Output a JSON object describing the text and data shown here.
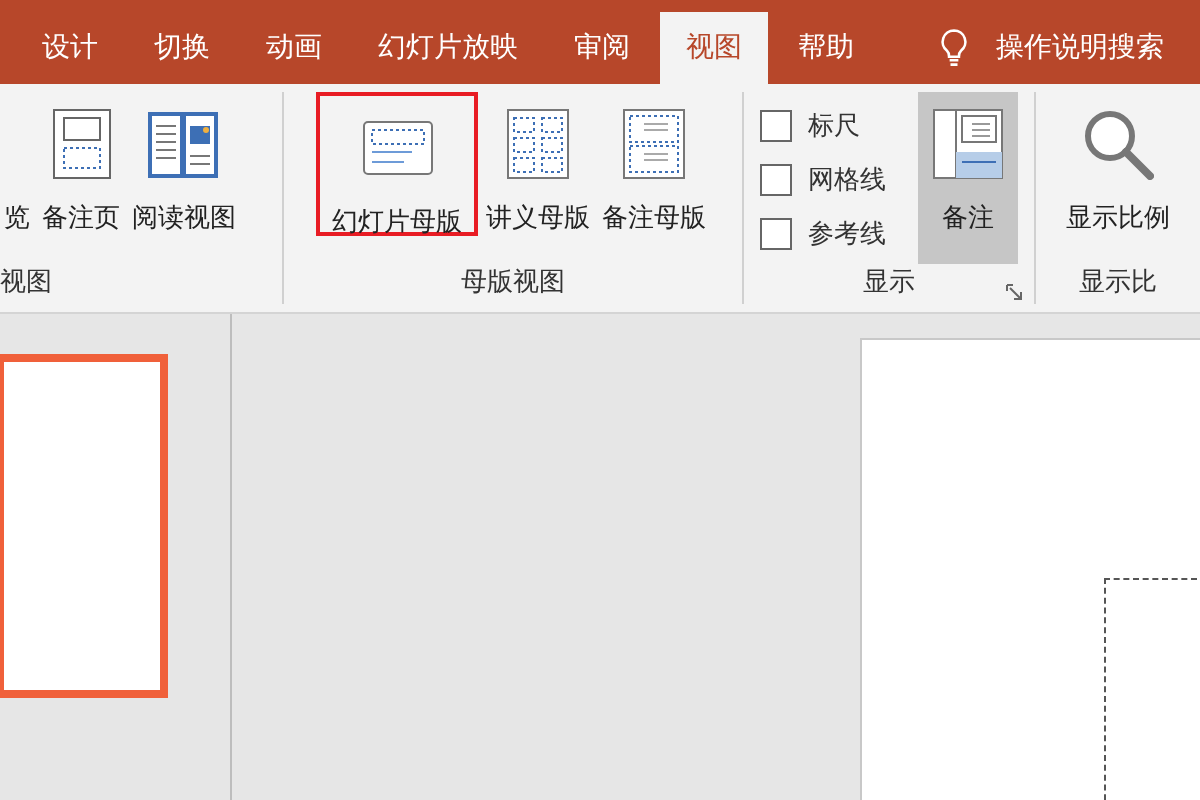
{
  "tabs": [
    {
      "label": "设计",
      "selected": false
    },
    {
      "label": "切换",
      "selected": false
    },
    {
      "label": "动画",
      "selected": false
    },
    {
      "label": "幻灯片放映",
      "selected": false
    },
    {
      "label": "审阅",
      "selected": false
    },
    {
      "label": "视图",
      "selected": true
    },
    {
      "label": "帮助",
      "selected": false
    }
  ],
  "search": {
    "label": "操作说明搜索"
  },
  "ribbon": {
    "groups": [
      {
        "label": "视图",
        "items": [
          {
            "kind": "text",
            "label": "览"
          },
          {
            "kind": "notes_page",
            "label": "备注页"
          },
          {
            "kind": "reading_view",
            "label": "阅读视图"
          }
        ]
      },
      {
        "label": "母版视图",
        "items": [
          {
            "kind": "slide_master",
            "label": "幻灯片母版",
            "outlined": true
          },
          {
            "kind": "handout_master",
            "label": "讲义母版",
            "outlined": false
          },
          {
            "kind": "notes_master",
            "label": "备注母版",
            "outlined": false
          }
        ]
      },
      {
        "label": "显示",
        "launcher": true,
        "checkboxes": [
          {
            "label": "标尺",
            "checked": false
          },
          {
            "label": "网格线",
            "checked": false
          },
          {
            "label": "参考线",
            "checked": false
          }
        ],
        "items": [
          {
            "kind": "notes",
            "label": "备注",
            "selected": true
          }
        ]
      },
      {
        "label": "显示比",
        "items": [
          {
            "kind": "zoom",
            "label": "显示比例"
          }
        ]
      }
    ]
  },
  "thumbnails": [
    {
      "selected": true
    }
  ]
}
